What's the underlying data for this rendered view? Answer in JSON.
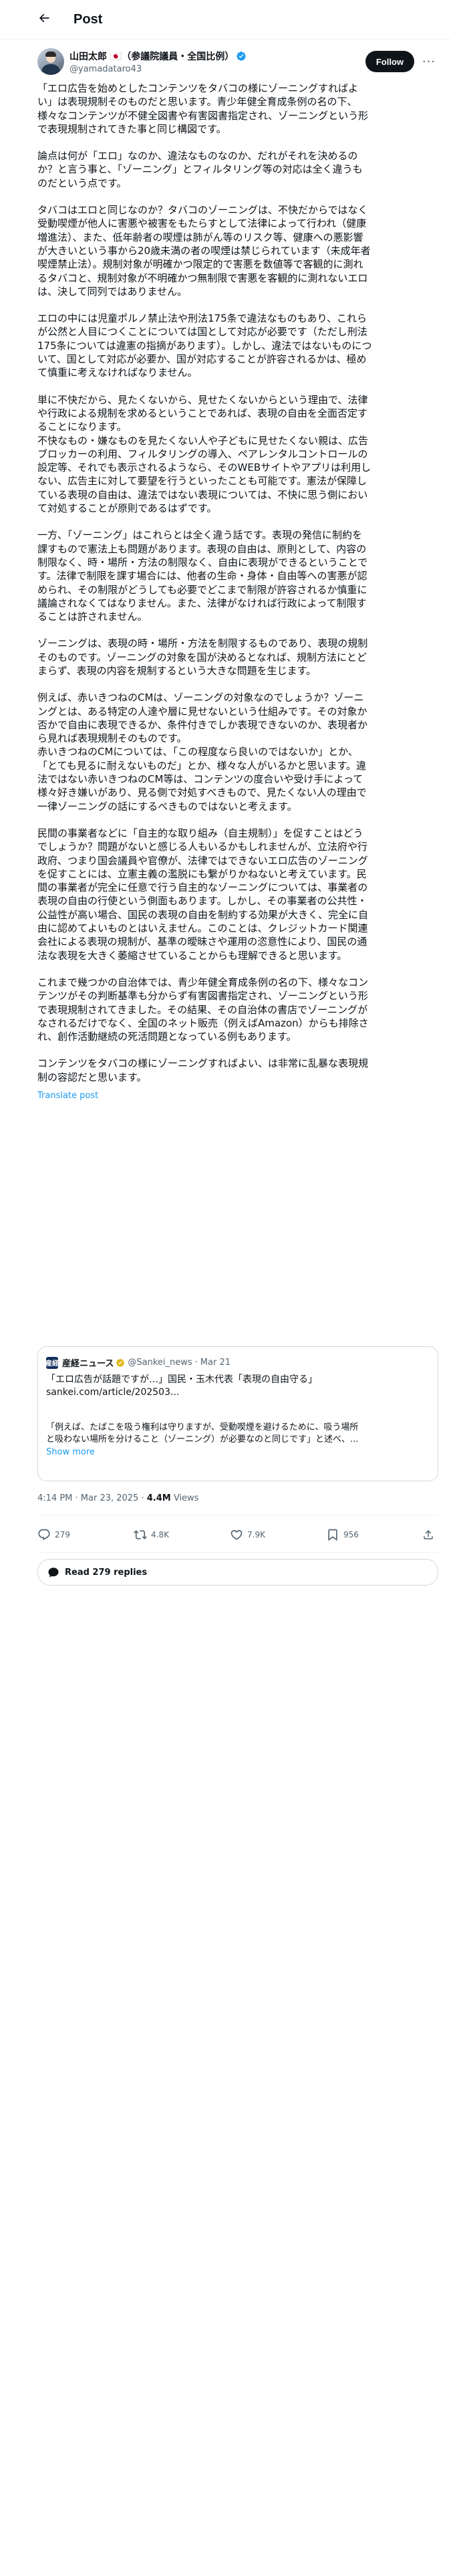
{
  "header": {
    "title": "Post"
  },
  "author": {
    "display_name": "山田太郎 🇯🇵（参議院議員・全国比例）",
    "handle": "@yamadataro43",
    "follow_label": "Follow",
    "more_label": "···"
  },
  "post": {
    "paragraphs": [
      "「エロ広告を始めとしたコンテンツをタバコの様にゾーニングすればよ\nい」は表現規制そのものだと思います。青少年健全育成条例の名の下、\n様々なコンテンツが不健全図書や有害図書指定され、ゾーニングという形\nで表現規制されてきた事と同じ構図です。",
      "論点は何が「エロ」なのか、違法なものなのか、だれがそれを決めるの\nか？と言う事と、「ゾーニング」とフィルタリング等の対応は全く違うも\nのだという点です。",
      "タバコはエロと同じなのか？タバコのゾーニングは、不快だからではなく\n受動喫煙が他人に害悪や被害をもたらすとして法律によって行われ（健康\n増進法）、また、低年齢者の喫煙は肺がん等のリスク等、健康への悪影響\nが大きいという事から20歳未満の者の喫煙は禁じられています（未成年者\n喫煙禁止法）。規制対象が明確かつ限定的で害悪を数値等で客観的に測れ\nるタバコと、規制対象が不明確かつ無制限で害悪を客観的に測れないエロ\nは、決して同列ではありません。",
      "エロの中には児童ポルノ禁止法や刑法175条で違法なものもあり、これら\nが公然と人目につくことについては国として対応が必要です（ただし刑法\n175条については違憲の指摘があります）。しかし、違法ではないものにつ\nいて、国として対応が必要か、国が対応することが許容されるかは、極め\nて慎重に考えなければなりません。",
      "単に不快だから、見たくないから、見せたくないからという理由で、法律\nや行政による規制を求めるということであれば、表現の自由を全面否定す\nることになります。\n不快なもの・嫌なものを見たくない人や子どもに見せたくない親は、広告\nブロッカーの利用、フィルタリングの導入、ペアレンタルコントロールの\n設定等、それでも表示されるようなら、そのWEBサイトやアプリは利用し\nない、広告主に対して要望を行うといったことも可能です。憲法が保障し\nている表現の自由は、違法ではない表現については、不快に思う側におい\nて対処することが原則であるはずです。",
      "一方、「ゾーニング」はこれらとは全く違う話です。表現の発信に制約を\n課すもので憲法上も問題があります。表現の自由は、原則として、内容の\n制限なく、時・場所・方法の制限なく、自由に表現ができるということで\nす。法律で制限を課す場合には、他者の生命・身体・自由等への害悪が認\nめられ、その制限がどうしても必要でどこまで制限が許容されるか慎重に\n議論されなくてはなりません。また、法律がなければ行政によって制限す\nることは許されません。",
      "ゾーニングは、表現の時・場所・方法を制限するものであり、表現の規制\nそのものです。ゾーニングの対象を国が決めるとなれば、規制方法にとど\nまらず、表現の内容を規制するという大きな問題を生じます。",
      "例えば、赤いきつねのCMは、ゾーニングの対象なのでしょうか？ゾーニ\nングとは、ある特定の人達や層に見せないという仕組みです。その対象か\n否かで自由に表現できるか、条件付きでしか表現できないのか、表現者か\nら見れば表現規制そのものです。\n赤いきつねのCMについては、「この程度なら良いのではないか」とか、\n「とても見るに耐えないものだ」とか、様々な人がいるかと思います。違\n法ではない赤いきつねのCM等は、コンテンツの度合いや受け手によって\n様々好き嫌いがあり、見る側で対処すべきもので、見たくない人の理由で\n一律ゾーニングの話にするべきものではないと考えます。",
      "民間の事業者などに「自主的な取り組み（自主規制）」を促すことはどう\nでしょうか？問題がないと感じる人もいるかもしれませんが、立法府や行\n政府、つまり国会議員や官僚が、法律ではできないエロ広告のゾーニング\nを促すことには、立憲主義の濫脱にも繋がりかねないと考えています。民\n間の事業者が完全に任意で行う自主的なゾーニングについては、事業者の\n表現の自由の行使という側面もあります。しかし、その事業者の公共性・\n公益性が高い場合、国民の表現の自由を制約する効果が大きく、完全に自\n由に認めてよいものとはいえません。このことは、クレジットカード関連\n会社による表現の規制が、基準の曖昧さや運用の恣意性により、国民の通\n法な表現を大きく萎縮させていることからも理解できると思います。",
      "これまで幾つかの自治体では、青少年健全育成条例の名の下、様々なコン\nテンツがその判断基準も分からず有害図書指定され、ゾーニングという形\nで表現規制されてきました。その結果、その自治体の書店でゾーニングが\nなされるだけでなく、全国のネット販売（例えばAmazon）からも排除さ\nれ、創作活動継続の死活問題となっている例もあります。",
      "コンテンツをタバコの様にゾーニングすればよい、は非常に乱暴な表現規\n制の容認だと思います。"
    ],
    "translate_label": "Translate post"
  },
  "quote": {
    "avatar_text": "産経",
    "source_name": "産経ニュース",
    "source_handle": "@Sankei_news",
    "date": "Mar 21",
    "text_lines": [
      "「エロ広告が話題ですが…」国民・玉木代表「表現の自由守る」",
      "sankei.com/article/202503..."
    ],
    "excerpt_lines": [
      "「例えば、たばこを吸う権利は守りますが、受動喫煙を避けるために、吸う場所",
      "と吸わない場所を分けること（ゾーニング）が必要なのと同じです」と述べ、..."
    ],
    "show_more_label": "Show more"
  },
  "meta": {
    "time": "4:14 PM · Mar 23, 2025 · ",
    "views_count": "4.4M",
    "views_label": " Views"
  },
  "actions": {
    "replies": "279",
    "reposts": "4.8K",
    "likes": "7.9K",
    "bookmarks": "956"
  },
  "read_replies": {
    "label": "Read 279 replies"
  },
  "colors": {
    "text": "#0f1419",
    "secondary": "#536471",
    "link": "#1d9bf0",
    "border": "#cfd9de",
    "divider": "#eff3f4",
    "verified_blue": "#1d9bf0",
    "verified_gold": "#e2b719"
  }
}
